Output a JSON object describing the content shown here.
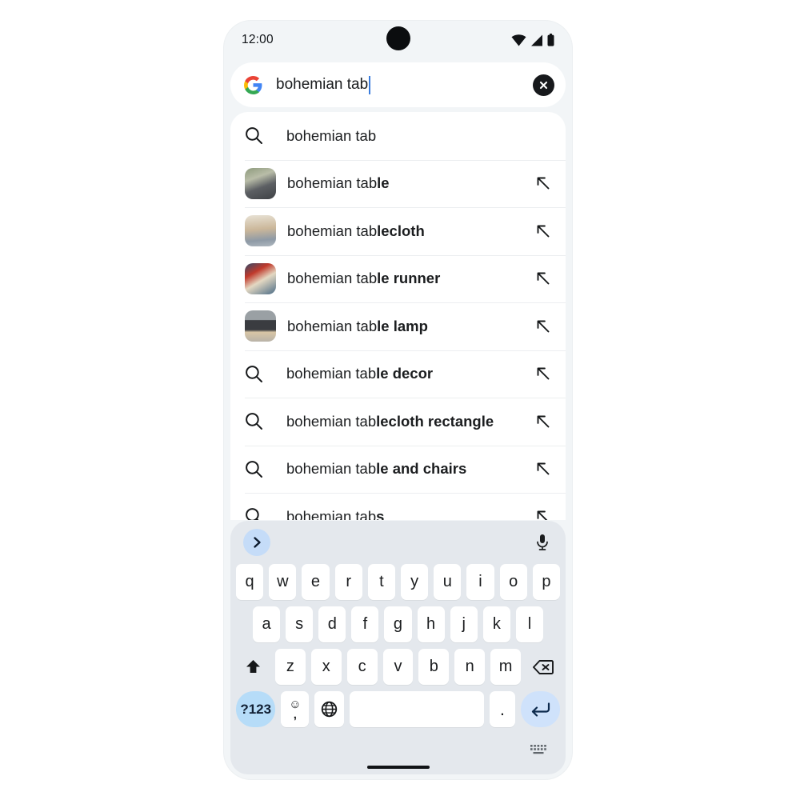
{
  "status_bar": {
    "time": "12:00",
    "icons": [
      "wifi-icon",
      "cellular-signal-icon",
      "battery-icon"
    ]
  },
  "search_bar": {
    "logo": "google-g-logo",
    "query": "bohemian tab",
    "clear_label": "clear-query",
    "clear_icon": "close-circle-icon"
  },
  "suggestions": [
    {
      "lead": "search-icon",
      "plain": "bohemian tab",
      "bold": "",
      "arrow": false
    },
    {
      "lead": "thumbnail",
      "plain": "bohemian tab",
      "bold": "le",
      "arrow": true
    },
    {
      "lead": "thumbnail",
      "plain": "bohemian tab",
      "bold": "lecloth",
      "arrow": true
    },
    {
      "lead": "thumbnail",
      "plain": "bohemian tab",
      "bold": "le runner",
      "arrow": true
    },
    {
      "lead": "thumbnail",
      "plain": "bohemian tab",
      "bold": "le lamp",
      "arrow": true
    },
    {
      "lead": "search-icon",
      "plain": "bohemian tab",
      "bold": "le decor",
      "arrow": true
    },
    {
      "lead": "search-icon",
      "plain": "bohemian tab",
      "bold": "lecloth rectangle",
      "arrow": true
    },
    {
      "lead": "search-icon",
      "plain": "bohemian tab",
      "bold": "le and chairs",
      "arrow": true
    },
    {
      "lead": "search-icon",
      "plain": "bohemian tab",
      "bold": "s",
      "arrow": true
    }
  ],
  "keyboard": {
    "expand_icon": "chevron-right-icon",
    "mic_icon": "microphone-icon",
    "row1": [
      "q",
      "w",
      "e",
      "r",
      "t",
      "y",
      "u",
      "i",
      "o",
      "p"
    ],
    "row2": [
      "a",
      "s",
      "d",
      "f",
      "g",
      "h",
      "j",
      "k",
      "l"
    ],
    "row3": [
      "z",
      "x",
      "c",
      "v",
      "b",
      "n",
      "m"
    ],
    "shift_icon": "shift-icon",
    "backspace_icon": "backspace-icon",
    "symbols_label": "?123",
    "emoji_glyph": "☺",
    "comma_glyph": ",",
    "globe_icon": "globe-icon",
    "space_label": "",
    "period_label": ".",
    "enter_icon": "enter-icon",
    "dismiss_icon": "keyboard-dismiss-icon"
  },
  "colors": {
    "phone_bg": "#f2f5f7",
    "keyboard_bg": "#e4e8ed",
    "key_bg": "#ffffff",
    "accent_blue": "#b6dcf8",
    "enter_blue": "#cfe2fb",
    "caret_blue": "#3b7ddd",
    "text": "#1b1d1f"
  }
}
